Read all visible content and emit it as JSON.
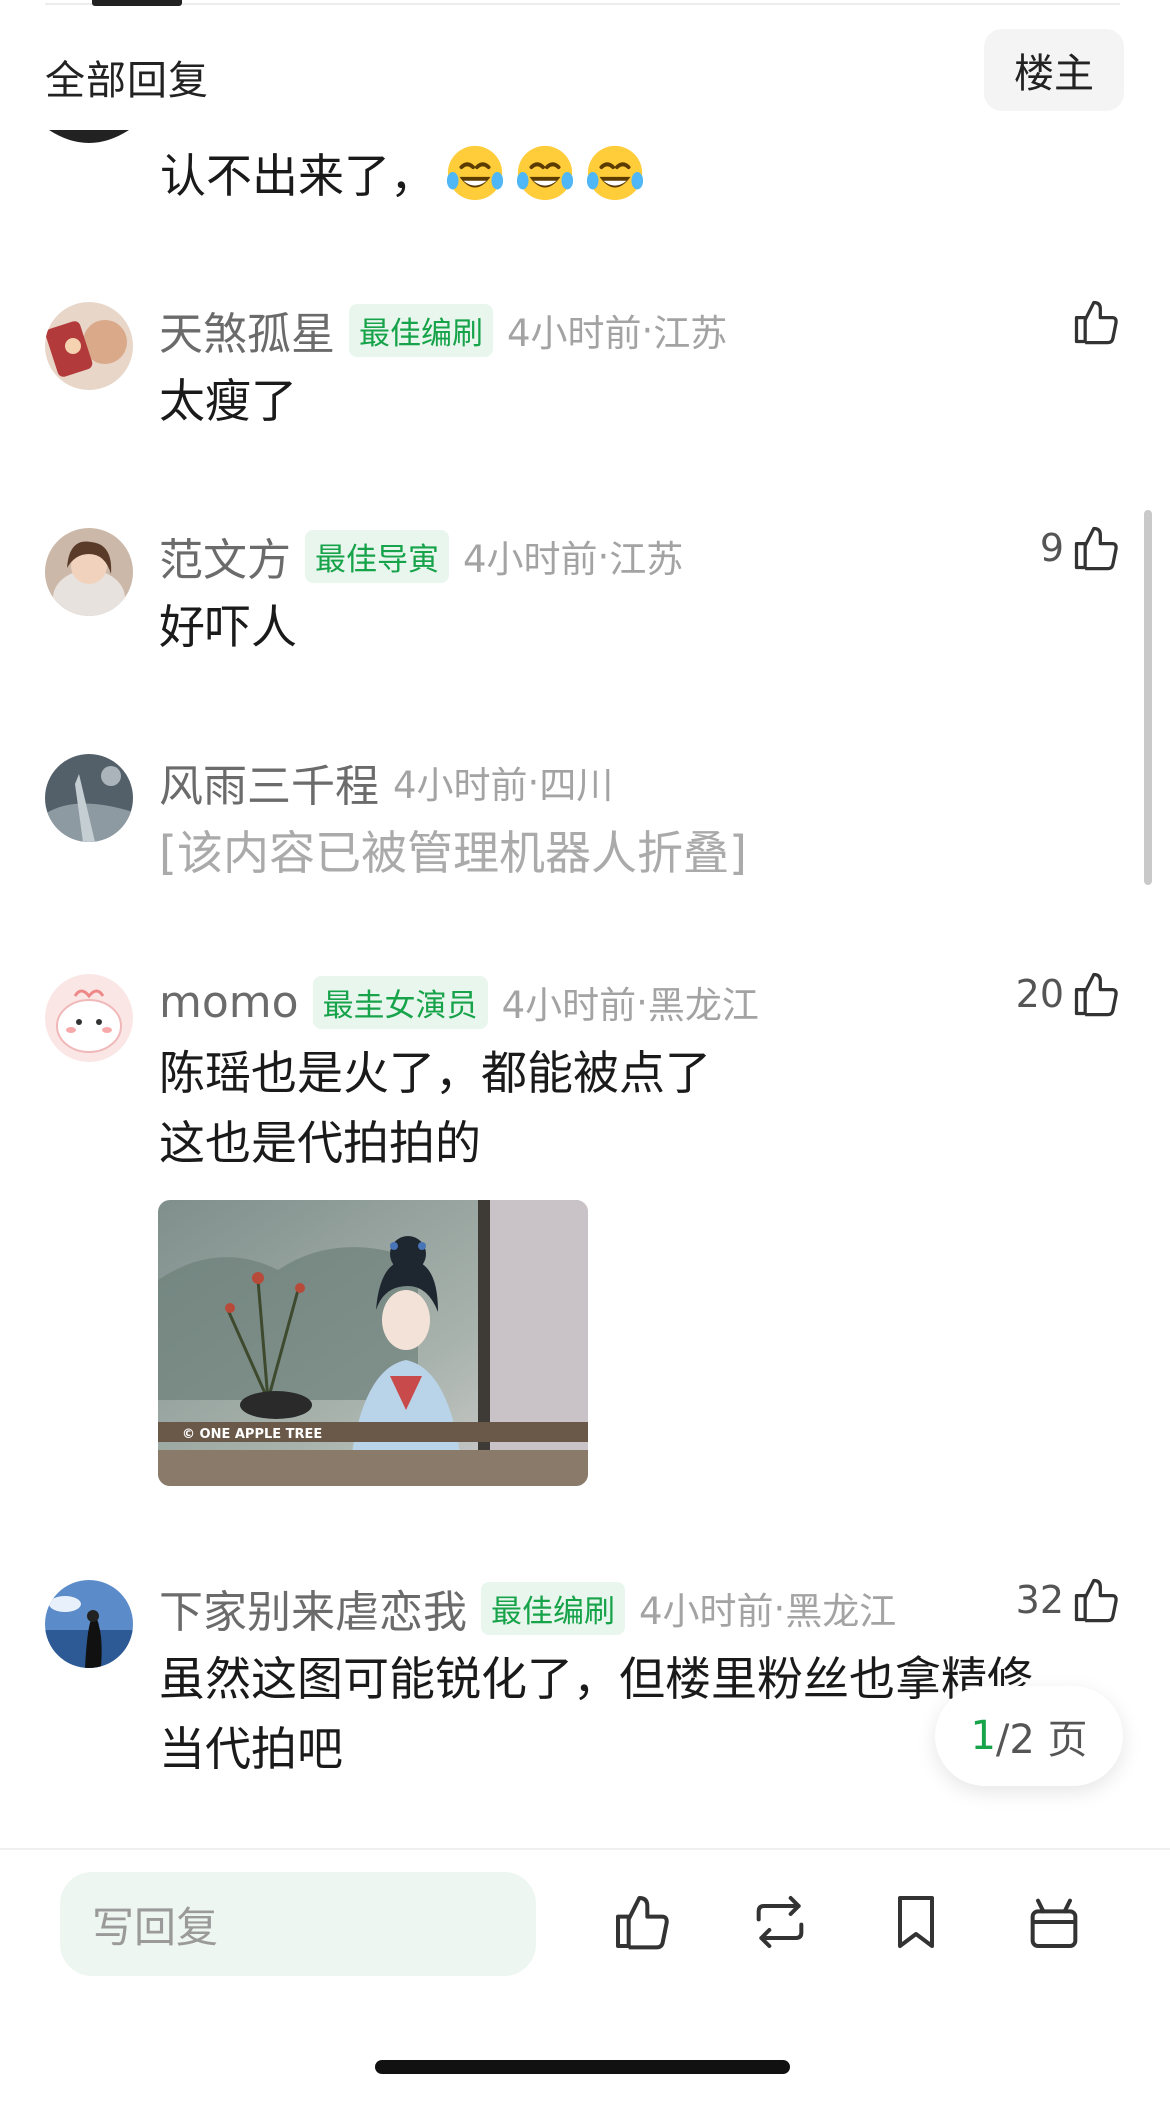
{
  "header": {
    "title": "全部回复",
    "louzhu_label": "楼主"
  },
  "first_comment": {
    "text": "认不出来了，",
    "emojis": [
      "laugh-cry-emoji",
      "laugh-cry-emoji",
      "laugh-cry-emoji"
    ]
  },
  "comments": [
    {
      "username": "天煞孤星",
      "badge": "最佳编刷",
      "time": "4小时前",
      "location": "江苏",
      "likes": "",
      "lines": [
        "太瘦了"
      ]
    },
    {
      "username": "范文方",
      "badge": "最佳导寅",
      "time": "4小时前",
      "location": "江苏",
      "likes": "9",
      "lines": [
        "好吓人"
      ]
    },
    {
      "username": "风雨三千程",
      "badge": "",
      "time": "4小时前",
      "location": "四川",
      "likes": "",
      "lines": [
        "[该内容已被管理机器人折叠]"
      ]
    },
    {
      "username": "momo",
      "badge": "最圭女演员",
      "time": "4小时前",
      "location": "黑龙江",
      "likes": "20",
      "lines": [
        "陈瑶也是火了，都能被点了",
        "这也是代拍拍的"
      ],
      "image_watermark": "© ONE APPLE TREE"
    },
    {
      "username": "下家别来虐恋我",
      "badge": "最佳编刷",
      "time": "4小时前",
      "location": "黑龙江",
      "likes": "32",
      "lines": [
        "虽然这图可能锐化了，但楼里粉丝也拿精修",
        "当代拍吧"
      ]
    }
  ],
  "meta_separator": " · ",
  "pagination": {
    "current": "1",
    "total": "/2 页"
  },
  "bottom_bar": {
    "reply_placeholder": "写回复",
    "icons": [
      "like-icon",
      "repost-icon",
      "bookmark-icon",
      "gift-icon"
    ]
  },
  "colors": {
    "accent_green": "#17a34a",
    "badge_bg": "#e9f6ee",
    "meta_gray": "#a3a3a3"
  }
}
